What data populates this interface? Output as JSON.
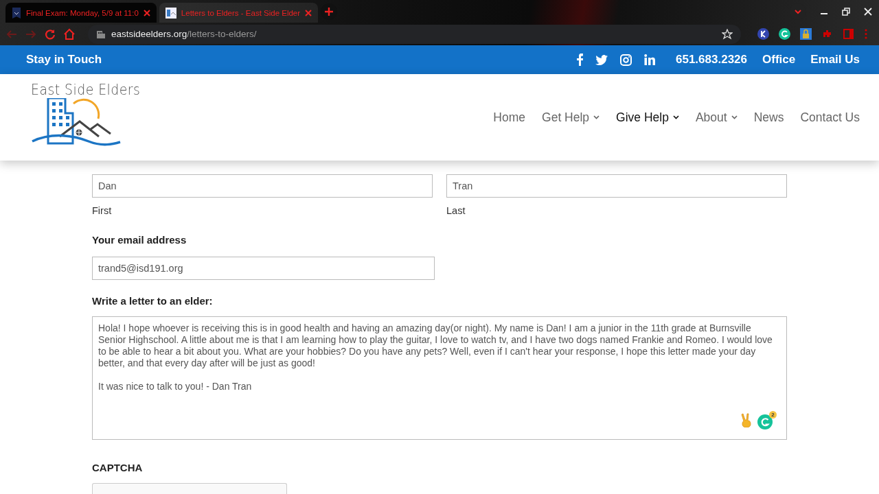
{
  "browser": {
    "tabs": [
      {
        "title": "Final Exam: Monday, 5/9 at 11:0",
        "selected": false
      },
      {
        "title": "Letters to Elders - East Side Elder",
        "selected": true
      }
    ],
    "url_domain": "eastsideelders.org",
    "url_path": "/letters-to-elders/"
  },
  "topbar": {
    "title": "Stay in Touch",
    "phone": "651.683.2326",
    "links": [
      "Office",
      "Email Us"
    ]
  },
  "header": {
    "logo_text": "East Side Elders",
    "nav": [
      {
        "label": "Home",
        "selected": false,
        "submenu": false
      },
      {
        "label": "Get Help",
        "selected": false,
        "submenu": true
      },
      {
        "label": "Give Help",
        "selected": true,
        "submenu": true
      },
      {
        "label": "About",
        "selected": false,
        "submenu": true
      },
      {
        "label": "News",
        "selected": false,
        "submenu": false
      },
      {
        "label": "Contact Us",
        "selected": false,
        "submenu": false
      }
    ]
  },
  "form": {
    "name_fields": [
      {
        "value": "Dan",
        "caption": "First"
      },
      {
        "value": "Tran",
        "caption": "Last"
      }
    ],
    "email_label": "Your email address",
    "email_value": "trand5@isd191.org",
    "letter_label": "Write a letter to an elder:",
    "letter_value": "Hola! I hope whoever is receiving this is in good health and having an amazing day(or night). My name is Dan! I am a junior in the 11th grade at Burnsville Senior Highschool. A little about me is that I am learning how to play the guitar, I love to watch tv, and I have two dogs named Frankie and Romeo. I would love to be able to hear a bit about you. What are your hobbies? Do you have any pets? Well, even if I can't hear your response, I hope this letter made your day better, and that every day after will be just as good!\n\nIt was nice to talk to you! - Dan Tran",
    "grammarly_count": "2",
    "captcha_label": "CAPTCHA"
  }
}
